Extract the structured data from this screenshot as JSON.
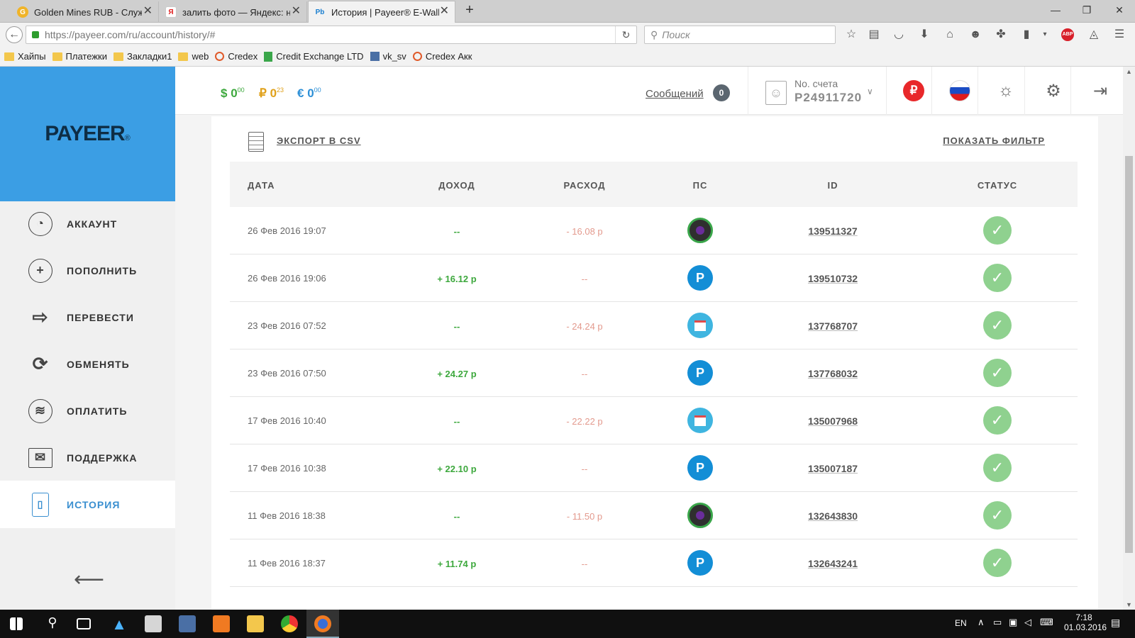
{
  "browser": {
    "tabs": [
      {
        "title": "Golden Mines RUB - Служ..."
      },
      {
        "title": "залить фото — Яндекс: н..."
      },
      {
        "title": "История | Payeer® E-Wall..."
      }
    ],
    "url": "https://payeer.com/ru/account/history/#",
    "search_placeholder": "Поиск",
    "bookmarks": [
      "Хайпы",
      "Платежки",
      "Закладки1",
      "web",
      "Credex",
      "Credit Exchange LTD",
      "vk_sv",
      "Credex Акк"
    ]
  },
  "app": {
    "logo": "PAYEER",
    "logo_mark": "®",
    "menu": [
      {
        "label": "АККАУНТ",
        "icon": "dashboard-icon"
      },
      {
        "label": "ПОПОЛНИТЬ",
        "icon": "plus-icon"
      },
      {
        "label": "ПЕРЕВЕСТИ",
        "icon": "arrow-right-icon"
      },
      {
        "label": "ОБМЕНЯТЬ",
        "icon": "exchange-icon"
      },
      {
        "label": "ОПЛАТИТЬ",
        "icon": "coins-icon"
      },
      {
        "label": "ПОДДЕРЖКА",
        "icon": "envelope-icon"
      },
      {
        "label": "ИСТОРИЯ",
        "icon": "book-icon"
      }
    ],
    "balances": [
      {
        "symbol": "$",
        "value": "0",
        "cents": "00",
        "color": "#3da83d"
      },
      {
        "symbol": "₽",
        "value": "0",
        "cents": "23",
        "color": "#e0a11b"
      },
      {
        "symbol": "€",
        "value": "0",
        "cents": "00",
        "color": "#2c8fd6"
      }
    ],
    "messages_label": "Сообщений",
    "messages_count": "0",
    "account_label": "No. счета",
    "account_number": "P24911720"
  },
  "history": {
    "export_label": "ЭКСПОРТ В CSV",
    "filter_label": "ПОКАЗАТЬ ФИЛЬТР",
    "columns": [
      "ДАТА",
      "ДОХОД",
      "РАСХОД",
      "ПС",
      "ID",
      "СТАТУС"
    ],
    "rows": [
      {
        "date": "26 Фев 2016 19:07",
        "income": "--",
        "expense": "- 16.08 р",
        "ps": "m",
        "id": "139511327"
      },
      {
        "date": "26 Фев 2016 19:06",
        "income": "+ 16.12 р",
        "expense": "--",
        "ps": "p",
        "id": "139510732"
      },
      {
        "date": "23 Фев 2016 07:52",
        "income": "--",
        "expense": "- 24.24 р",
        "ps": "s",
        "id": "137768707"
      },
      {
        "date": "23 Фев 2016 07:50",
        "income": "+ 24.27 р",
        "expense": "--",
        "ps": "p",
        "id": "137768032"
      },
      {
        "date": "17 Фев 2016 10:40",
        "income": "--",
        "expense": "- 22.22 р",
        "ps": "s",
        "id": "135007968"
      },
      {
        "date": "17 Фев 2016 10:38",
        "income": "+ 22.10 р",
        "expense": "--",
        "ps": "p",
        "id": "135007187"
      },
      {
        "date": "11 Фев 2016 18:38",
        "income": "--",
        "expense": "- 11.50 р",
        "ps": "m",
        "id": "132643830"
      },
      {
        "date": "11 Фев 2016 18:37",
        "income": "+ 11.74 р",
        "expense": "--",
        "ps": "p",
        "id": "132643241"
      }
    ]
  },
  "taskbar": {
    "lang": "EN",
    "time": "7:18",
    "date": "01.03.2016"
  }
}
